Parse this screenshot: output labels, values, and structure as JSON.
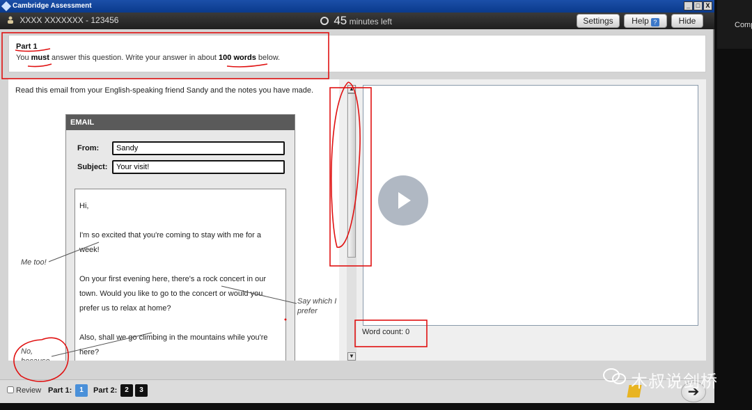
{
  "side_peek": "Comp",
  "window": {
    "title": "Cambridge Assessment",
    "controls": [
      "_",
      "□",
      "X"
    ]
  },
  "topbar": {
    "candidate": "XXXX XXXXXXX - 123456",
    "timer_value": "45",
    "timer_suffix": "minutes left",
    "settings_label": "Settings",
    "help_label": "Help",
    "hide_label": "Hide"
  },
  "instructions": {
    "part_title": "Part 1",
    "pre": "You ",
    "must": "must",
    "mid": " answer this question. Write your answer in about ",
    "words": "100 words",
    "post": " below."
  },
  "task": {
    "intro": "Read this email from your English-speaking friend Sandy and the notes you have made.",
    "email": {
      "header": "EMAIL",
      "from_label": "From:",
      "from_value": "Sandy",
      "subject_label": "Subject:",
      "subject_value": "Your visit!",
      "body": [
        "Hi,",
        "",
        "I'm so excited that you're coming to stay with me for a week!",
        "",
        "On your first evening here, there's a rock concert in our town. Would you like to go to the concert or would you prefer us to relax at home?",
        "",
        "Also, shall we go climbing in the mountains while you're here?"
      ]
    },
    "notes": {
      "me_too": "Me too!",
      "say_which": "Say which I prefer",
      "no_because": "No, because ..."
    }
  },
  "answer": {
    "value": "",
    "word_count_label": "Word count: 0"
  },
  "bottom": {
    "review_label": "Review",
    "part1_label": "Part 1:",
    "part1_pages": [
      "1"
    ],
    "part2_label": "Part 2:",
    "part2_pages": [
      "2",
      "3"
    ]
  },
  "watermark": "木叔说剑桥"
}
